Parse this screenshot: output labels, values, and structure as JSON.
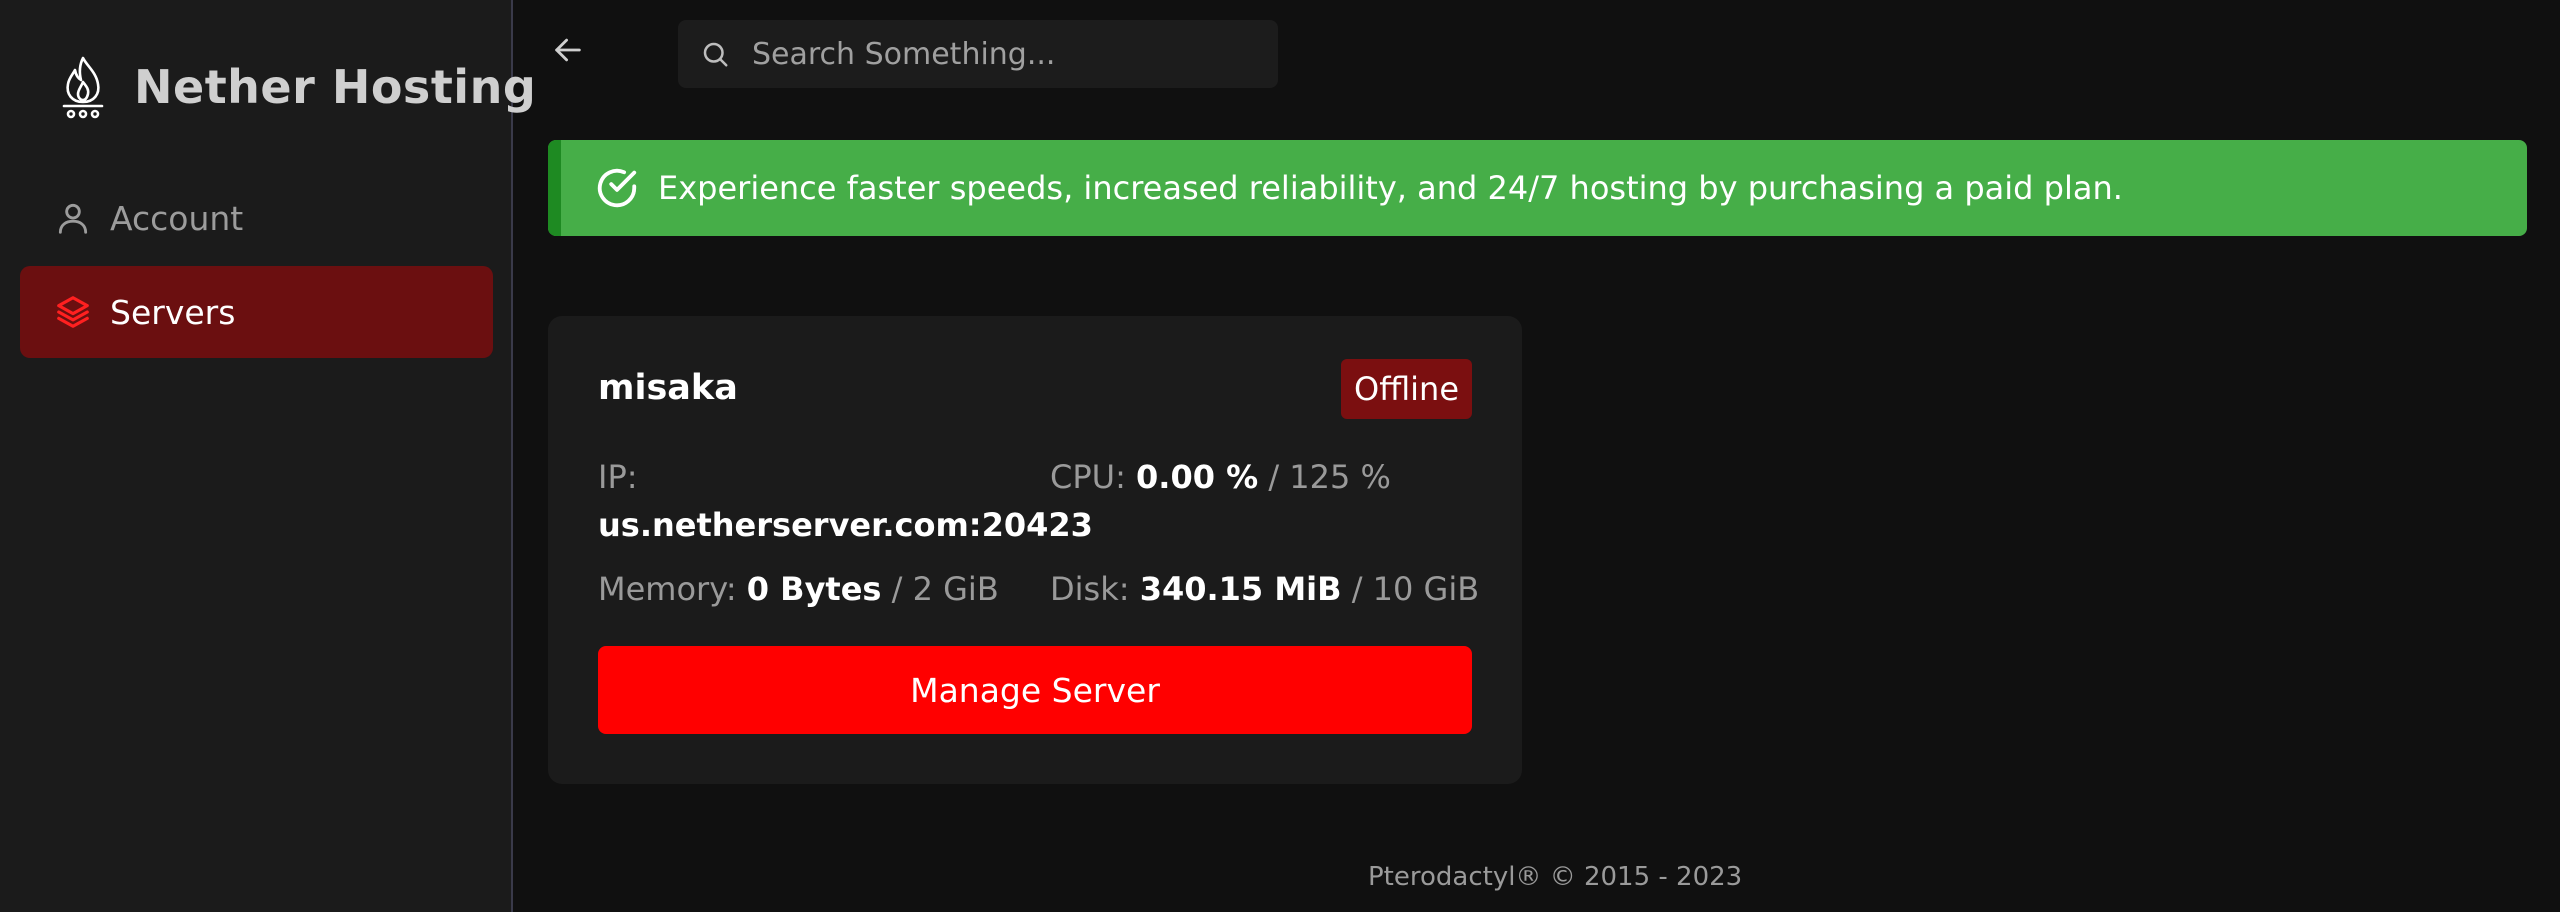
{
  "sidebar": {
    "brand": {
      "name": "Nether Hosting",
      "icon": "flame-logo-icon"
    },
    "items": [
      {
        "label": "Account",
        "icon": "user-icon",
        "active": false
      },
      {
        "label": "Servers",
        "icon": "layers-icon",
        "active": true
      }
    ]
  },
  "topbar": {
    "back_icon": "arrow-left-icon",
    "search": {
      "icon": "search-icon",
      "placeholder": "Search Something..."
    }
  },
  "banner": {
    "icon": "check-circle-icon",
    "text": "Experience faster speeds, increased reliability, and 24/7 hosting by purchasing a paid plan."
  },
  "server_card": {
    "name": "misaka",
    "status": "Offline",
    "ip": {
      "label": "IP:",
      "value": "us.netherserver.com:20423"
    },
    "cpu": {
      "label": "CPU:",
      "used": "0.00 %",
      "limit": "/ 125 %"
    },
    "memory": {
      "label": "Memory:",
      "used": "0 Bytes",
      "limit": "/ 2 GiB"
    },
    "disk": {
      "label": "Disk:",
      "used": "340.15 MiB",
      "limit": "/ 10 GiB"
    },
    "manage_button": "Manage Server"
  },
  "footer": {
    "text": "Pterodactyl® © 2015 - 2023"
  },
  "colors": {
    "background": "#101010",
    "sidebar": "#1b1b1b",
    "active_nav": "#6b0f10",
    "banner": "#46ae48",
    "banner_accent": "#1e8a22",
    "status_offline": "#7b0f10",
    "manage_button": "#ff0000"
  }
}
